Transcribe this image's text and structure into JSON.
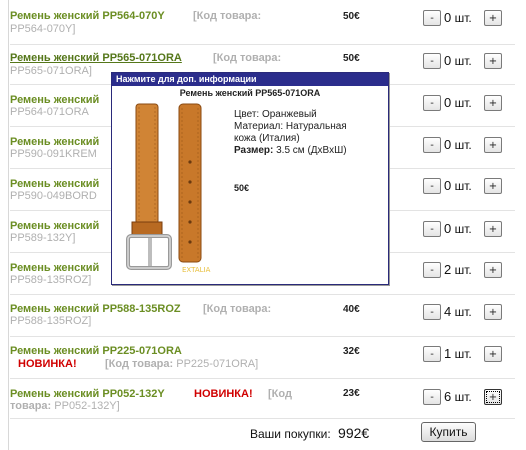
{
  "products": [
    {
      "name": "Ремень женский PP564-070Y",
      "code_label": "[Код товара:",
      "code_text": "PP564-070Y]",
      "price": "50€",
      "qty": "0",
      "unit": "шт.",
      "new": false
    },
    {
      "name": "Ремень женский PP565-071ORA",
      "code_label": "[Код товара:",
      "code_text": "PP565-071ORA]",
      "price": "50€",
      "qty": "0",
      "unit": "шт.",
      "new": false
    },
    {
      "name": "Ремень женский",
      "code_label": "",
      "code_text": "PP564-071ORA",
      "price": "",
      "qty": "0",
      "unit": "шт.",
      "new": false
    },
    {
      "name": "Ремень женский",
      "code_label": "",
      "code_text": "PP590-091KREM",
      "price": "",
      "qty": "0",
      "unit": "шт.",
      "new": false
    },
    {
      "name": "Ремень женский",
      "code_label": "",
      "code_text": "PP590-049BORD",
      "price": "",
      "qty": "0",
      "unit": "шт.",
      "new": false
    },
    {
      "name": "Ремень женский",
      "code_label": "",
      "code_text": "PP589-132Y]",
      "price": "",
      "qty": "0",
      "unit": "шт.",
      "new": false
    },
    {
      "name": "Ремень женский",
      "code_label": "",
      "code_text": "PP589-135ROZ]",
      "price": "",
      "qty": "2",
      "unit": "шт.",
      "new": false
    },
    {
      "name": "Ремень женский PP588-135ROZ",
      "code_label": "[Код товара:",
      "code_text": "PP588-135ROZ]",
      "price": "40€",
      "qty": "4",
      "unit": "шт.",
      "new": false
    },
    {
      "name": "Ремень женский PP225-071ORA",
      "code_label": "[Код товара:",
      "code_text": "PP225-071ORA]",
      "price": "32€",
      "qty": "1",
      "unit": "шт.",
      "new": true,
      "new_label": "НОВИНКА!"
    },
    {
      "name": "Ремень женский PP052-132Y",
      "code_label": "[Код",
      "code_label2": "товара:",
      "code_text": "PP052-132Y]",
      "price": "23€",
      "qty": "6",
      "unit": "шт.",
      "new": true,
      "new_label": "НОВИНКА!"
    }
  ],
  "buttons": {
    "minus": "-",
    "plus": "+",
    "buy": "Купить"
  },
  "total": {
    "label": "Ваши покупки:",
    "value": "992€"
  },
  "popup": {
    "header": "Нажмите для доп. информации",
    "title": "Ремень женский PP565-071ORA",
    "color_line": "Цвет: Оранжевый",
    "material_line1": "Материал: Натуральная",
    "material_line2": "кожа (Италия)",
    "size_label": "Размер:",
    "size_value": "3.5 см (ДхВхШ)",
    "price": "50€",
    "watermark": "EXTALIA"
  }
}
